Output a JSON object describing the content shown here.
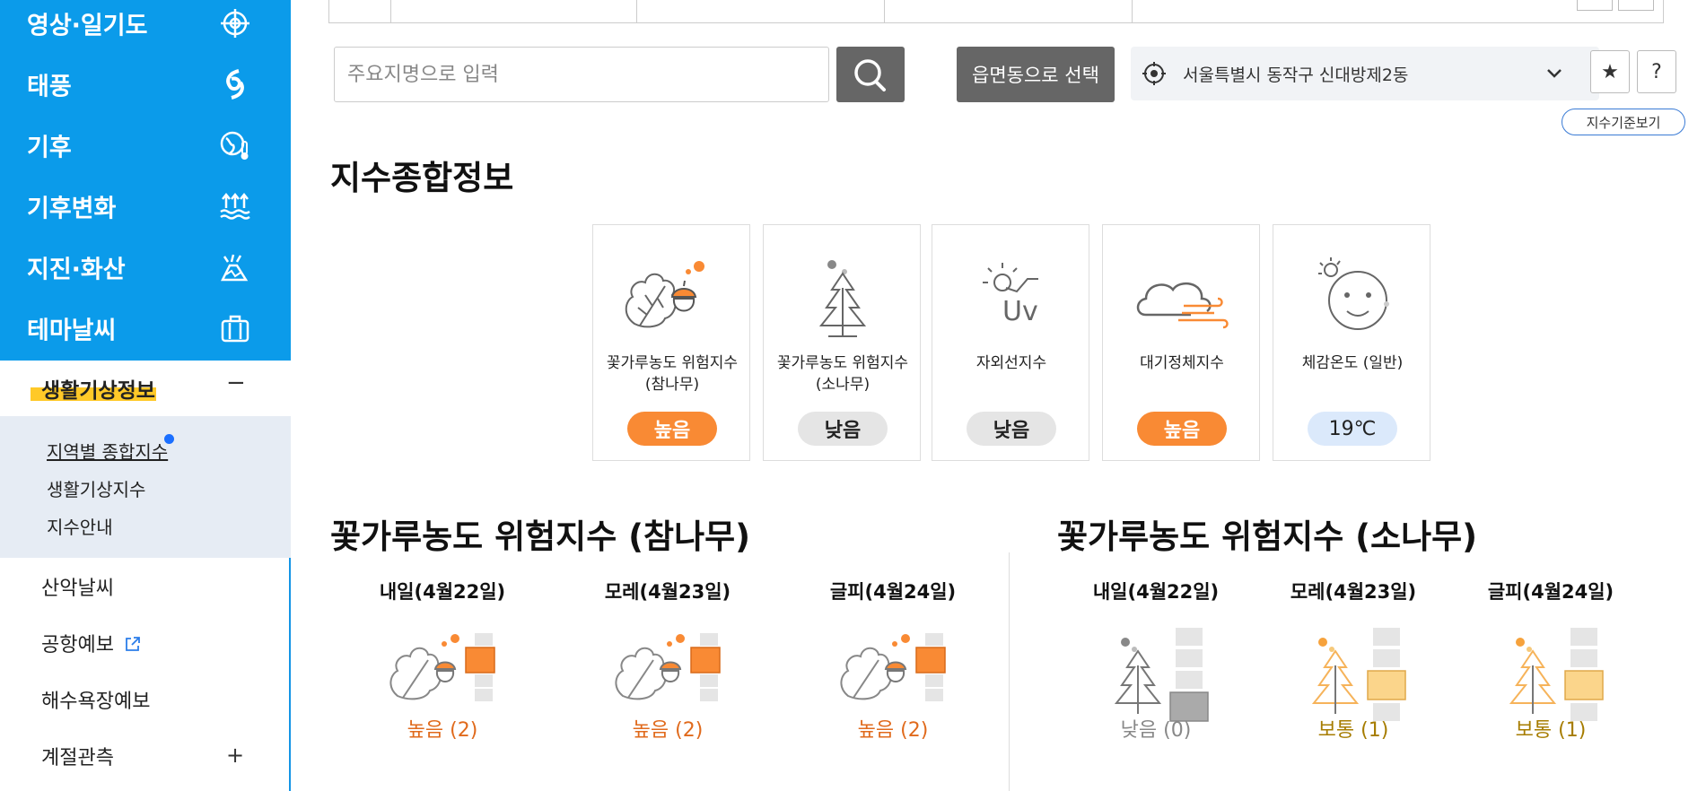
{
  "sidebar": {
    "items": [
      {
        "label": "영상·일기도",
        "icon": "satellite-icon"
      },
      {
        "label": "태풍",
        "icon": "typhoon-icon"
      },
      {
        "label": "기후",
        "icon": "globe-thermometer-icon"
      },
      {
        "label": "기후변화",
        "icon": "sea-level-icon"
      },
      {
        "label": "지진·화산",
        "icon": "volcano-icon"
      },
      {
        "label": "테마날씨",
        "icon": "suitcase-icon"
      }
    ],
    "open_section": {
      "label": "생활기상정보",
      "toggle": "−"
    },
    "sub_items": [
      "지역별 종합지수",
      "생활기상지수",
      "지수안내"
    ],
    "plain_items": [
      "산악날씨",
      "공항예보",
      "해수욕장예보",
      "계절관측"
    ],
    "seasonal_toggle": "+"
  },
  "search": {
    "placeholder": "주요지명으로 입력"
  },
  "select_button": "읍면동으로 선택",
  "location": {
    "value": "서울특별시 동작구 신대방제2동"
  },
  "star_button": "★",
  "help_button": "?",
  "standard_button": "지수기준보기",
  "overview": {
    "title": "지수종합정보",
    "cards": [
      {
        "name_line1": "꽃가루농도 위험지수",
        "name_line2": "(참나무)",
        "value": "높음",
        "level": "high",
        "icon": "oak-pollen-icon"
      },
      {
        "name_line1": "꽃가루농도 위험지수",
        "name_line2": "(소나무)",
        "value": "낮음",
        "level": "low",
        "icon": "pine-pollen-icon"
      },
      {
        "name_line1": "자외선지수",
        "name_line2": "",
        "value": "낮음",
        "level": "low",
        "icon": "uv-icon"
      },
      {
        "name_line1": "대기정체지수",
        "name_line2": "",
        "value": "높음",
        "level": "high",
        "icon": "cloud-wind-icon"
      },
      {
        "name_line1": "체감온도 (일반)",
        "name_line2": "",
        "value": "19℃",
        "level": "temp",
        "icon": "face-sun-icon"
      }
    ]
  },
  "oak": {
    "title": "꽃가루농도 위험지수 (참나무)",
    "days": [
      {
        "label": "내일(4월22일)",
        "value": "높음 (2)"
      },
      {
        "label": "모레(4월23일)",
        "value": "높음 (2)"
      },
      {
        "label": "글피(4월24일)",
        "value": "높음 (2)"
      }
    ]
  },
  "pine": {
    "title": "꽃가루농도 위험지수 (소나무)",
    "days": [
      {
        "label": "내일(4월22일)",
        "value": "낮음 (0)"
      },
      {
        "label": "모레(4월23일)",
        "value": "보통 (1)"
      },
      {
        "label": "글피(4월24일)",
        "value": "보통 (1)"
      }
    ]
  },
  "colors": {
    "brand": "#0b9bea",
    "high": "#f98a34",
    "moderate": "#f6c97a",
    "low": "#999999",
    "high_text": "#e06a1c",
    "moderate_text": "#a67c00"
  }
}
